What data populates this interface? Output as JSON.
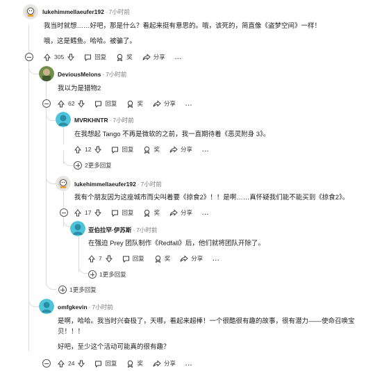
{
  "comments": [
    {
      "author": "lukehimmellaeufer192",
      "time": "7小时前",
      "lines": [
        "我当时就想……好吧，那是什么？看起来挺有意思的。哦，该死的，简直像《盗梦空间》一样！",
        "哦，这是鳕鱼。哈哈。被骗了。"
      ],
      "votes": "305"
    },
    {
      "author": "DeviousMelons",
      "time": "7小时前",
      "lines": [
        "我以为是猎物2"
      ],
      "votes": "62"
    },
    {
      "author": "MVRKHNTR",
      "time": "7小时前",
      "lines": [
        "在我想起 Tango 不再是微软的之前，我一直期待着《恶灵附身 3》。"
      ],
      "votes": "12",
      "more_replies": "2更多回复"
    },
    {
      "author": "lukehimmellaeufer192",
      "time": "7小时前",
      "lines": [
        "我有个朋友因为这座城市而尖叫着要《掠食2》！！是啊……真怀疑我们能不能买到《掠食2》。"
      ],
      "votes": "17"
    },
    {
      "author": "亚伯拉罕·伊苏斯",
      "time": "7小时前",
      "lines": [
        "在强迫 Prey 团队制作《Redfall》后，他们就将团队开除了。"
      ],
      "votes": "7",
      "more_replies": "1更多回复"
    },
    {
      "author": "omfgkevin",
      "time": "7小时前",
      "lines": [
        "是啊，哈哈。我当时兴奋极了，天哪，看起来超棒！一个很酷很有趣的故事，很有潜力——使命召唤宝",
        "贝！！！",
        "好吧，至少这个活动可能真的很有趣？"
      ],
      "votes": "24"
    }
  ],
  "thread_more_replies": "1更多回复",
  "actions": {
    "reply": "回复",
    "award": "奖",
    "share": "分享",
    "more": "..."
  },
  "colors": {
    "text": "#1c1c1c",
    "muted": "#7c7c7c",
    "line": "#dcdcdc"
  }
}
